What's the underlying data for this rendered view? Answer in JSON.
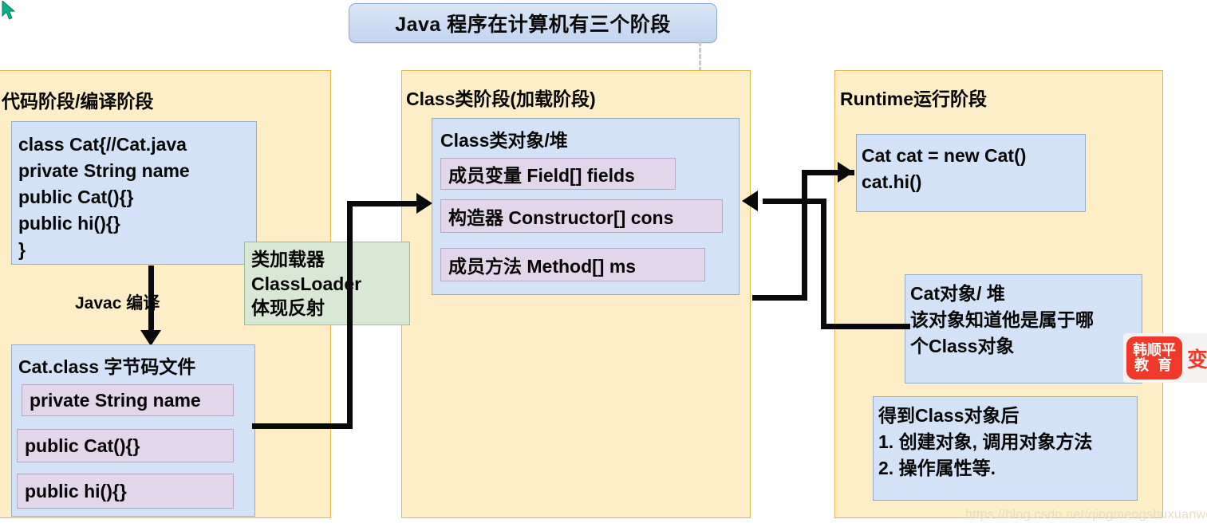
{
  "title": {
    "text": "Java 程序在计算机有三个阶段"
  },
  "stages": [
    {
      "id": "compile",
      "title": "代码阶段/编译阶段",
      "source_card": {
        "lines": [
          "class Cat{//Cat.java",
          "private String name",
          "public Cat(){}",
          "public hi(){}",
          "}"
        ]
      },
      "edge_label": "Javac 编译",
      "class_file_card": {
        "title": "Cat.class 字节码文件",
        "members": [
          "private String name",
          "public Cat(){}",
          "public hi(){}"
        ]
      }
    },
    {
      "id": "classload",
      "title": "Class类阶段(加载阶段)",
      "class_object_card": {
        "title": "Class类对象/堆",
        "members": [
          "成员变量 Field[] fields",
          "构造器 Constructor[] cons",
          "成员方法 Method[] ms"
        ]
      }
    },
    {
      "id": "runtime",
      "title": "Runtime运行阶段",
      "code_card": {
        "lines": [
          "Cat cat = new Cat()",
          "cat.hi()"
        ]
      },
      "object_card": {
        "lines": [
          "Cat对象/ 堆",
          "该对象知道他是属于哪",
          "个Class对象"
        ]
      },
      "usage_card": {
        "lines": [
          "得到Class对象后",
          "1. 创建对象, 调用对象方法",
          "2. 操作属性等."
        ]
      }
    }
  ],
  "classloader_box": {
    "lines": [
      "类加载器",
      "ClassLoader",
      "体现反射"
    ]
  },
  "logo": {
    "line1": "韩顺平",
    "line2": "教 育",
    "side": "变"
  },
  "watermark": {
    "text": "https://blog.csdn.net/qingmengshuxuanwo"
  },
  "colors": {
    "stage_fill": "#fdeec8",
    "stage_border": "#e2b84d",
    "card_fill": "#d3e2f7",
    "card_border": "#9aacc6",
    "row_fill": "#e2d6ea",
    "row_border": "#b9a5c6",
    "green_fill": "#d8e8d4",
    "green_border": "#9bbd96",
    "connector": "#0a0a0a",
    "title_fill": "#cddcf2",
    "logo_red": "#f0392b"
  },
  "icons": {
    "cursor": "cursor-arrow-icon"
  }
}
